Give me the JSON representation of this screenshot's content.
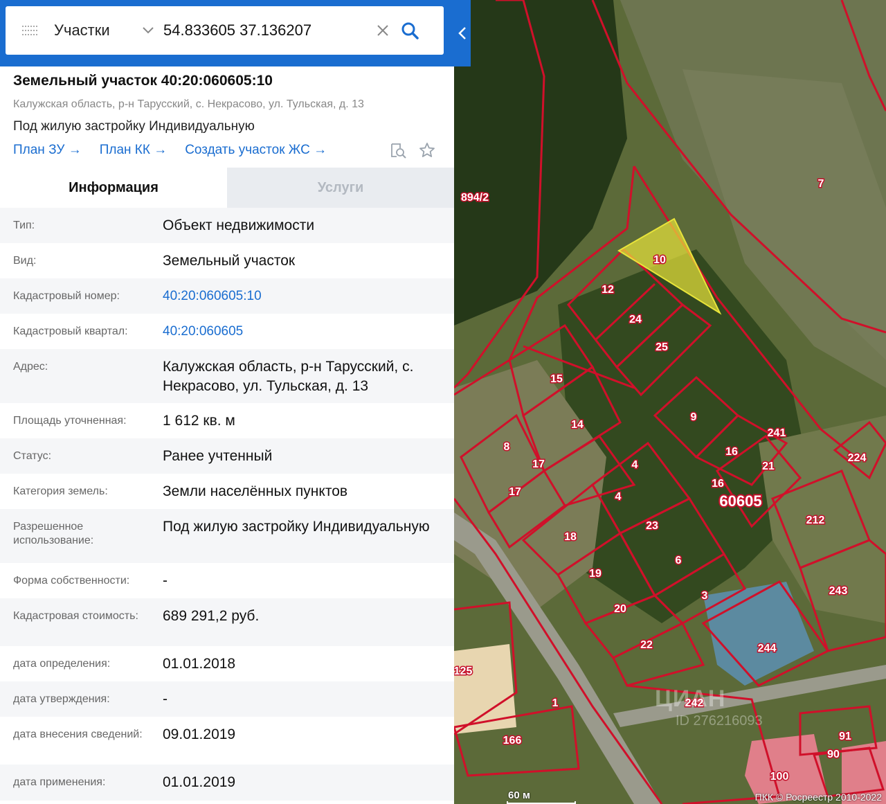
{
  "search": {
    "type_label": "Участки",
    "query": "54.833605 37.136207"
  },
  "object": {
    "title": "Земельный участок 40:20:060605:10",
    "address": "Калужская область, р-н Тарусский, с. Некрасово, ул. Тульская, д. 13",
    "usage": "Под жилую застройку Индивидуальную",
    "links": [
      "План ЗУ",
      "План КК",
      "Создать участок ЖС"
    ]
  },
  "tabs": [
    {
      "label": "Информация",
      "active": true
    },
    {
      "label": "Услуги",
      "active": false
    }
  ],
  "info_rows": [
    {
      "label": "Тип:",
      "value": "Объект недвижимости"
    },
    {
      "label": "Вид:",
      "value": "Земельный участок"
    },
    {
      "label": "Кадастровый номер:",
      "value": "40:20:060605:10",
      "link": true
    },
    {
      "label": "Кадастровый квартал:",
      "value": "40:20:060605",
      "link": true
    },
    {
      "label": "Адрес:",
      "value": "Калужская область, р-н Тарусский, с. Некрасово, ул. Тульская, д. 13"
    },
    {
      "label": "Площадь уточненная:",
      "value": "1 612 кв. м"
    },
    {
      "label": "Статус:",
      "value": "Ранее учтенный"
    },
    {
      "label": "Категория земель:",
      "value": "Земли населённых пунктов"
    },
    {
      "label": "Разрешенное использование:",
      "value": "Под жилую застройку Индивидуальную"
    },
    {
      "label": "Форма собственности:",
      "value": "-"
    },
    {
      "label": "Кадастровая стоимость:",
      "value": "689 291,2 руб."
    },
    {
      "label": "дата определения:",
      "value": "01.01.2018"
    },
    {
      "label": "дата утверждения:",
      "value": "-"
    },
    {
      "label": "дата внесения сведений:",
      "value": "09.01.2019"
    },
    {
      "label": "дата применения:",
      "value": "01.01.2019"
    }
  ],
  "map": {
    "quarter_label": "60605",
    "parcel_labels": [
      "894/2",
      "7",
      "10",
      "12",
      "24",
      "25",
      "15",
      "14",
      "9",
      "241",
      "8",
      "17",
      "17",
      "16",
      "16",
      "21",
      "4",
      "4",
      "23",
      "18",
      "6",
      "19",
      "3",
      "20",
      "22",
      "212",
      "224",
      "243",
      "244",
      "125",
      "1",
      "242",
      "166",
      "91",
      "90",
      "100"
    ],
    "scale_label": "60 м",
    "copyright": "ПКК © Росреестр 2010-2022",
    "watermark": "ЦИАН",
    "watermark_id": "ID 276216093",
    "colors": {
      "boundary": "#d0102a",
      "highlight": "#e8e43a"
    }
  },
  "icons": {
    "menu": "menu-icon",
    "dropdown": "chevron-down-icon",
    "clear": "close-icon",
    "search": "search-icon",
    "collapse": "chevron-left-icon",
    "zoom_doc": "document-search-icon",
    "favorite": "star-icon"
  }
}
